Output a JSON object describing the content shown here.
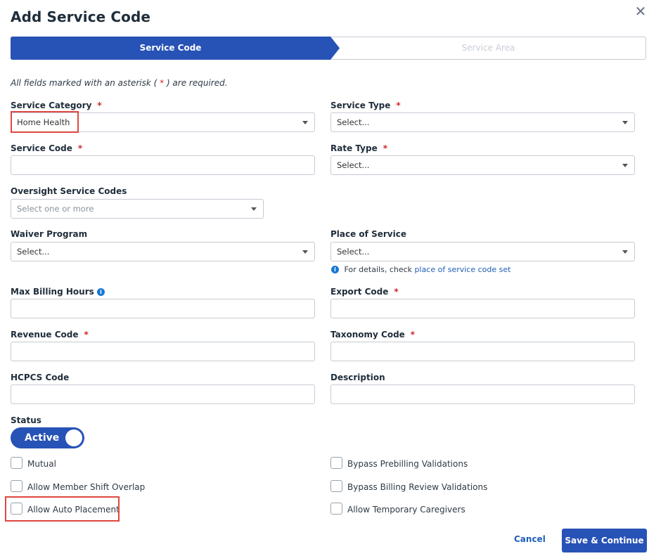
{
  "dialog": {
    "title": "Add Service Code",
    "close_symbol": "✕"
  },
  "stepper": {
    "steps": [
      {
        "label": "Service Code",
        "state": "active"
      },
      {
        "label": "Service Area",
        "state": "inactive"
      }
    ]
  },
  "required_note": {
    "prefix": "All fields marked with an asterisk (",
    "star": " * ",
    "suffix": ") are required."
  },
  "required_marker": "*",
  "fields": {
    "service_category": {
      "label": "Service Category",
      "value": "Home Health"
    },
    "service_type": {
      "label": "Service Type",
      "placeholder": "Select..."
    },
    "service_code": {
      "label": "Service Code",
      "value": ""
    },
    "rate_type": {
      "label": "Rate Type",
      "placeholder": "Select..."
    },
    "oversight_service_codes": {
      "label": "Oversight Service Codes",
      "placeholder": "Select one or more"
    },
    "waiver_program": {
      "label": "Waiver Program",
      "placeholder": "Select..."
    },
    "place_of_service": {
      "label": "Place of Service",
      "placeholder": "Select...",
      "hint_prefix": "For details, check ",
      "hint_link": "place of service code set"
    },
    "max_billing_hours": {
      "label": "Max Billing Hours",
      "value": ""
    },
    "export_code": {
      "label": "Export Code",
      "value": ""
    },
    "revenue_code": {
      "label": "Revenue Code",
      "value": ""
    },
    "taxonomy_code": {
      "label": "Taxonomy Code",
      "value": ""
    },
    "hcpcs_code": {
      "label": "HCPCS Code",
      "value": ""
    },
    "description": {
      "label": "Description",
      "value": ""
    }
  },
  "status": {
    "label": "Status",
    "toggle_label": "Active",
    "on": true
  },
  "checkboxes": {
    "mutual": {
      "label": "Mutual",
      "checked": false
    },
    "allow_member_shift_overlap": {
      "label": "Allow Member Shift Overlap",
      "checked": false
    },
    "allow_auto_placement": {
      "label": "Allow Auto Placement",
      "checked": false
    },
    "bypass_prebilling_validations": {
      "label": "Bypass Prebilling Validations",
      "checked": false
    },
    "bypass_billing_review_validations": {
      "label": "Bypass Billing Review Validations",
      "checked": false
    },
    "allow_temporary_caregivers": {
      "label": "Allow Temporary Caregivers",
      "checked": false
    }
  },
  "info_icon_glyph": "i",
  "footer": {
    "cancel_label": "Cancel",
    "save_label": "Save & Continue"
  },
  "colors": {
    "primary": "#2752b6",
    "required": "#d0252c",
    "highlight": "#e0473f",
    "link": "#1f5fb8",
    "info": "#1778d3"
  }
}
